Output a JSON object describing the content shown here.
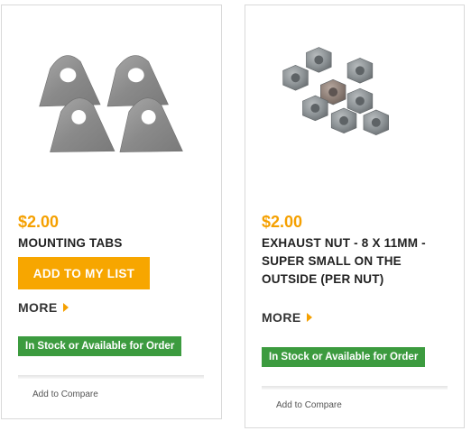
{
  "products": [
    {
      "image_alt": "Mounting tabs image",
      "price": "$2.00",
      "title": "MOUNTING TABS",
      "add_button": "ADD TO MY LIST",
      "more_label": "MORE",
      "stock_label": "In Stock or Available for Order",
      "compare_label": "Add to Compare"
    },
    {
      "image_alt": "Exhaust nuts image",
      "price": "$2.00",
      "title": "EXHAUST NUT - 8 X 11MM - SUPER SMALL ON THE OUTSIDE (PER NUT)",
      "more_label": "MORE",
      "stock_label": "In Stock or Available for Order",
      "compare_label": "Add to Compare"
    }
  ],
  "colors": {
    "price": "#f5a000",
    "button": "#f7a600",
    "stock_badge": "#3c9b3f"
  }
}
